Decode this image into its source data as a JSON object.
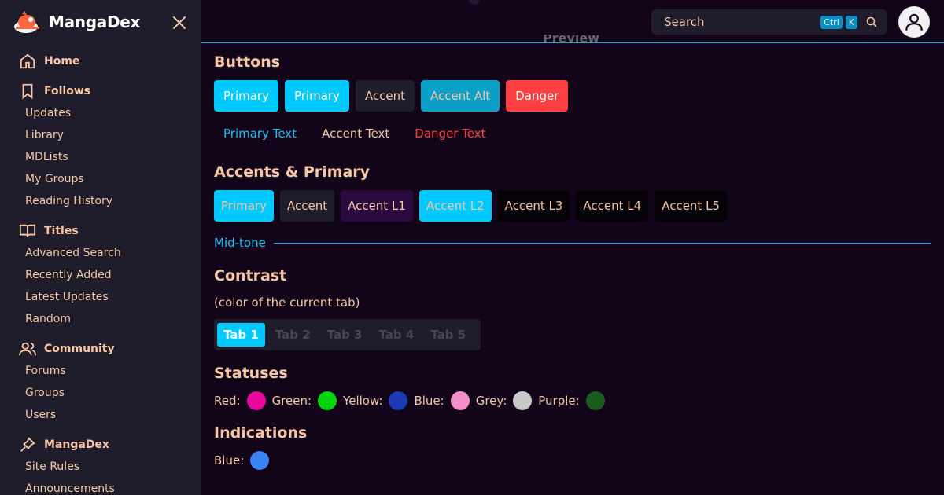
{
  "sidebar": {
    "brand": "MangaDex",
    "sections": [
      {
        "title": "Home",
        "icon": "home-icon",
        "items": []
      },
      {
        "title": "Follows",
        "icon": "bookmark-icon",
        "items": [
          "Updates",
          "Library",
          "MDLists",
          "My Groups",
          "Reading History"
        ]
      },
      {
        "title": "Titles",
        "icon": "book-open-icon",
        "items": [
          "Advanced Search",
          "Recently Added",
          "Latest Updates",
          "Random"
        ]
      },
      {
        "title": "Community",
        "icon": "users-icon",
        "items": [
          "Forums",
          "Groups",
          "Users"
        ]
      },
      {
        "title": "MangaDex",
        "icon": "pin-icon",
        "items": [
          "Site Rules",
          "Announcements"
        ]
      }
    ]
  },
  "topbar": {
    "search_placeholder": "Search",
    "kbd_ctrl": "Ctrl",
    "kbd_k": "K",
    "preview_label": "Preview"
  },
  "main": {
    "buttons_title": "Buttons",
    "buttons": [
      {
        "label": "Primary",
        "bg": "#00c9ff",
        "fg": "#ffffff"
      },
      {
        "label": "Primary",
        "bg": "#00c9ff",
        "fg": "#ffffff"
      },
      {
        "label": "Accent",
        "bg": "#1f1d2b",
        "fg": "#f2c7a6"
      },
      {
        "label": "Accent Alt",
        "bg": "#0aa0c8",
        "fg": "#f2c7a6"
      },
      {
        "label": "Danger",
        "bg": "#ff4040",
        "fg": "#ffffff"
      }
    ],
    "text_buttons": [
      {
        "label": "Primary Text",
        "fg": "#1ec3f6"
      },
      {
        "label": "Accent Text",
        "fg": "#f2c7a6"
      },
      {
        "label": "Danger Text",
        "fg": "#ff4040"
      }
    ],
    "accents_title": "Accents & Primary",
    "accents": [
      {
        "label": "Primary",
        "bg": "#00c9ff",
        "fg": "#f2c7a6"
      },
      {
        "label": "Accent",
        "bg": "#1f1d2b",
        "fg": "#f2c7a6"
      },
      {
        "label": "Accent L1",
        "bg": "#2a0a3e",
        "fg": "#f2c7a6"
      },
      {
        "label": "Accent L2",
        "bg": "#00c9ff",
        "fg": "#f2c7a6"
      },
      {
        "label": "Accent L3",
        "bg": "#060208",
        "fg": "#f2c7a6"
      },
      {
        "label": "Accent L4",
        "bg": "#060208",
        "fg": "#f2c7a6"
      },
      {
        "label": "Accent L5",
        "bg": "#060208",
        "fg": "#f2c7a6"
      }
    ],
    "midtone_label": "Mid-tone",
    "contrast_title": "Contrast",
    "contrast_sub": "(color of the current tab)",
    "tabs": [
      "Tab 1",
      "Tab 2",
      "Tab 3",
      "Tab 4",
      "Tab 5"
    ],
    "active_tab": 0,
    "statuses_title": "Statuses",
    "statuses": [
      {
        "label": "Red:",
        "color": "#e6079b"
      },
      {
        "label": "Green:",
        "color": "#05d40d"
      },
      {
        "label": "Yellow:",
        "color": "#1a3bb5"
      },
      {
        "label": "Blue:",
        "color": "#f68fc9"
      },
      {
        "label": "Grey:",
        "color": "#c8c8c8"
      },
      {
        "label": "Purple:",
        "color": "#1a5c1f"
      }
    ],
    "indications_title": "Indications",
    "indications": [
      {
        "label": "Blue:",
        "color": "#3b82f6"
      }
    ]
  }
}
